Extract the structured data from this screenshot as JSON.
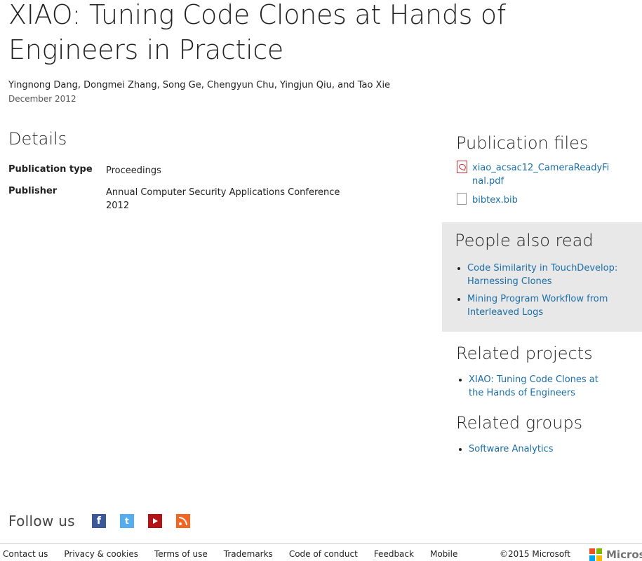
{
  "publication": {
    "title": "XIAO: Tuning Code Clones at Hands of Engineers in Practice",
    "authors": "Yingnong Dang, Dongmei Zhang, Song Ge, Chengyun Chu, Yingjun Qiu, and Tao Xie",
    "date": "December 2012"
  },
  "details": {
    "heading": "Details",
    "rows": [
      {
        "key": "Publication type",
        "value": "Proceedings"
      },
      {
        "key": "Publisher",
        "value": "Annual Computer Security Applications Conference 2012"
      }
    ]
  },
  "publication_files": {
    "heading": "Publication files",
    "files": [
      {
        "name": "xiao_acsac12_CameraReadyFinal.pdf",
        "icon": "pdf-icon"
      },
      {
        "name": "bibtex.bib",
        "icon": "document-icon"
      }
    ]
  },
  "people_also_read": {
    "heading": "People also read",
    "items": [
      "Code Similarity in TouchDevelop: Harnessing Clones",
      "Mining Program Workflow from Interleaved Logs"
    ]
  },
  "related_projects": {
    "heading": "Related projects",
    "items": [
      "XIAO: Tuning Code Clones at the Hands of Engineers"
    ]
  },
  "related_groups": {
    "heading": "Related groups",
    "items": [
      "Software Analytics"
    ]
  },
  "follow": {
    "label": "Follow us",
    "icons": [
      "facebook-icon",
      "twitter-icon",
      "youtube-icon",
      "rss-icon"
    ]
  },
  "footer": {
    "links": [
      "Contact us",
      "Privacy & cookies",
      "Terms of use",
      "Trademarks",
      "Code of conduct",
      "Feedback",
      "Mobile"
    ],
    "copyright": "©2015 Microsoft",
    "brand": "Microsoft"
  },
  "colors": {
    "link": "#1b6ea8",
    "sidebar_bg": "#e8e8e8",
    "ms_red": "#f25022",
    "ms_green": "#7fba00",
    "ms_blue": "#00a4ef",
    "ms_yellow": "#ffb900"
  }
}
